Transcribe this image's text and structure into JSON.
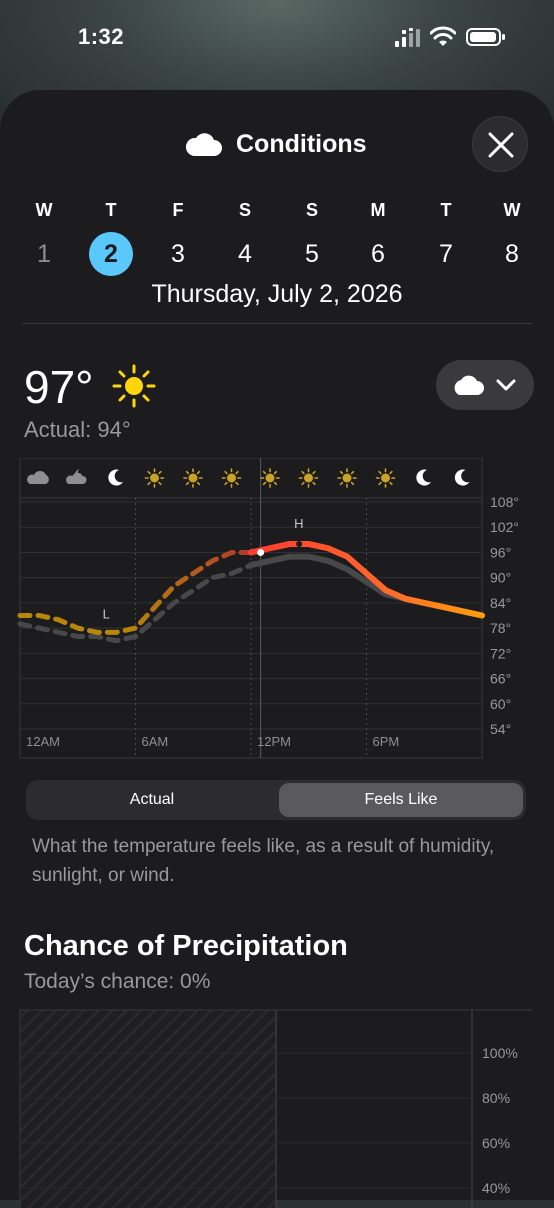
{
  "status_bar": {
    "time": "1:32"
  },
  "sheet": {
    "title": "Conditions",
    "title_icon": "cloud-icon",
    "close_icon": "close-icon"
  },
  "days": [
    {
      "dow": "W",
      "num": "1",
      "state": "past"
    },
    {
      "dow": "T",
      "num": "2",
      "state": "selected"
    },
    {
      "dow": "F",
      "num": "3",
      "state": "future"
    },
    {
      "dow": "S",
      "num": "4",
      "state": "future"
    },
    {
      "dow": "S",
      "num": "5",
      "state": "future"
    },
    {
      "dow": "M",
      "num": "6",
      "state": "future"
    },
    {
      "dow": "T",
      "num": "7",
      "state": "future"
    },
    {
      "dow": "W",
      "num": "8",
      "state": "future"
    }
  ],
  "selected_date": "Thursday, July 2, 2026",
  "current": {
    "temp": "97°",
    "icon": "sun-icon",
    "actual": "Actual: 94°",
    "layer_button_icon": "cloud-icon"
  },
  "chart_data": {
    "type": "line",
    "hour_icons": [
      "cloud-icon",
      "cloud-moon-icon",
      "moon-icon",
      "sun-icon",
      "sun-icon",
      "sun-icon",
      "sun-icon",
      "sun-icon",
      "sun-icon",
      "sun-icon",
      "moon-icon",
      "moon-icon"
    ],
    "y_ticks": [
      "108°",
      "102°",
      "96°",
      "90°",
      "84°",
      "78°",
      "72°",
      "66°",
      "60°",
      "54°"
    ],
    "x_ticks": [
      "12AM",
      "6AM",
      "12PM",
      "6PM"
    ],
    "ylim": [
      54,
      108
    ],
    "now_hour": 12.5,
    "low_marker": {
      "label": "L",
      "hour": 4.5,
      "value": 77
    },
    "high_marker": {
      "label": "H",
      "hour": 14.5,
      "value": 98
    },
    "series": [
      {
        "name": "Feels Like",
        "x": [
          0,
          1,
          2,
          3,
          4,
          5,
          6,
          7,
          8,
          9,
          10,
          11,
          12,
          13,
          14,
          15,
          16,
          17,
          18,
          19,
          20,
          21,
          22,
          23,
          24
        ],
        "values": [
          81,
          81,
          80,
          78,
          77,
          77,
          78,
          83,
          88,
          91,
          94,
          96,
          96,
          97,
          98,
          98,
          97,
          95,
          91,
          87,
          85,
          84,
          83,
          82,
          81
        ]
      },
      {
        "name": "Actual",
        "x": [
          0,
          1,
          2,
          3,
          4,
          5,
          6,
          7,
          8,
          9,
          10,
          11,
          12,
          13,
          14,
          15,
          16,
          17,
          18,
          19,
          20,
          21,
          22,
          23,
          24
        ],
        "values": [
          79,
          78,
          77,
          76,
          76,
          75,
          76,
          80,
          84,
          87,
          90,
          91,
          93,
          94,
          95,
          95,
          94,
          92,
          89,
          86,
          85,
          84,
          83,
          82,
          81
        ]
      }
    ]
  },
  "toggle": {
    "option_a": "Actual",
    "option_b": "Feels Like",
    "selected": "Feels Like"
  },
  "explanation": "What the temperature feels like, as a result of humidity, sunlight, or wind.",
  "precipitation": {
    "title": "Chance of Precipitation",
    "subtitle": "Today’s chance: 0%",
    "y_ticks": [
      "100%",
      "80%",
      "60%",
      "40%"
    ]
  },
  "colors": {
    "accent": "#5ac8fa",
    "hot": "#ff453a",
    "warm": "#ff9f0a",
    "mild": "#d98a0a",
    "sun": "#ffd60a"
  }
}
